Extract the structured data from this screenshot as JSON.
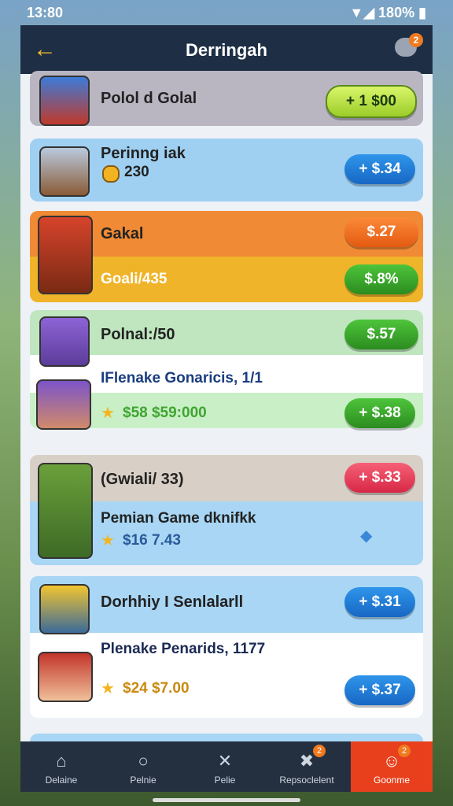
{
  "status": {
    "time": "13:80",
    "battery": "180%"
  },
  "header": {
    "title": "Derringah",
    "badge": "2"
  },
  "rows": [
    {
      "name": "Polol d Golal",
      "button": "+ 1 $00"
    },
    {
      "name": "Perinng iak",
      "amount": "230",
      "button": "+ $.34"
    },
    {
      "name": "Gakal",
      "button": "$.27",
      "sub": "Goali/435",
      "button2": "$.8%"
    },
    {
      "name": "Polnal:/50",
      "button": "$.57",
      "sub": "IFlenake Gonaricis, 1/1",
      "amount": "$58 $59:000",
      "button2": "+ $.38"
    },
    {
      "name": "(Gwiali/ 33)",
      "button": "+ $.33",
      "sub": "Pemian Game dknifkk",
      "amount": "$16 7.43"
    },
    {
      "name": "Dorhhiy I Senlalarll",
      "button": "+ $.31",
      "sub": "Plenake Penarids, 1177",
      "amount": "$24 $7.00",
      "button2": "+ $.37"
    }
  ],
  "nav": [
    {
      "label": "Delaine",
      "icon": "home-icon"
    },
    {
      "label": "Pelnie",
      "icon": "search-icon"
    },
    {
      "label": "Pelie",
      "icon": "swords-icon"
    },
    {
      "label": "Repsoclelent",
      "icon": "tools-icon",
      "badge": "2"
    },
    {
      "label": "Goonme",
      "icon": "face-icon",
      "badge": "2"
    }
  ],
  "colors": {
    "accent": "#f6c12a",
    "header": "#1e2f45",
    "active": "#e8401d"
  }
}
